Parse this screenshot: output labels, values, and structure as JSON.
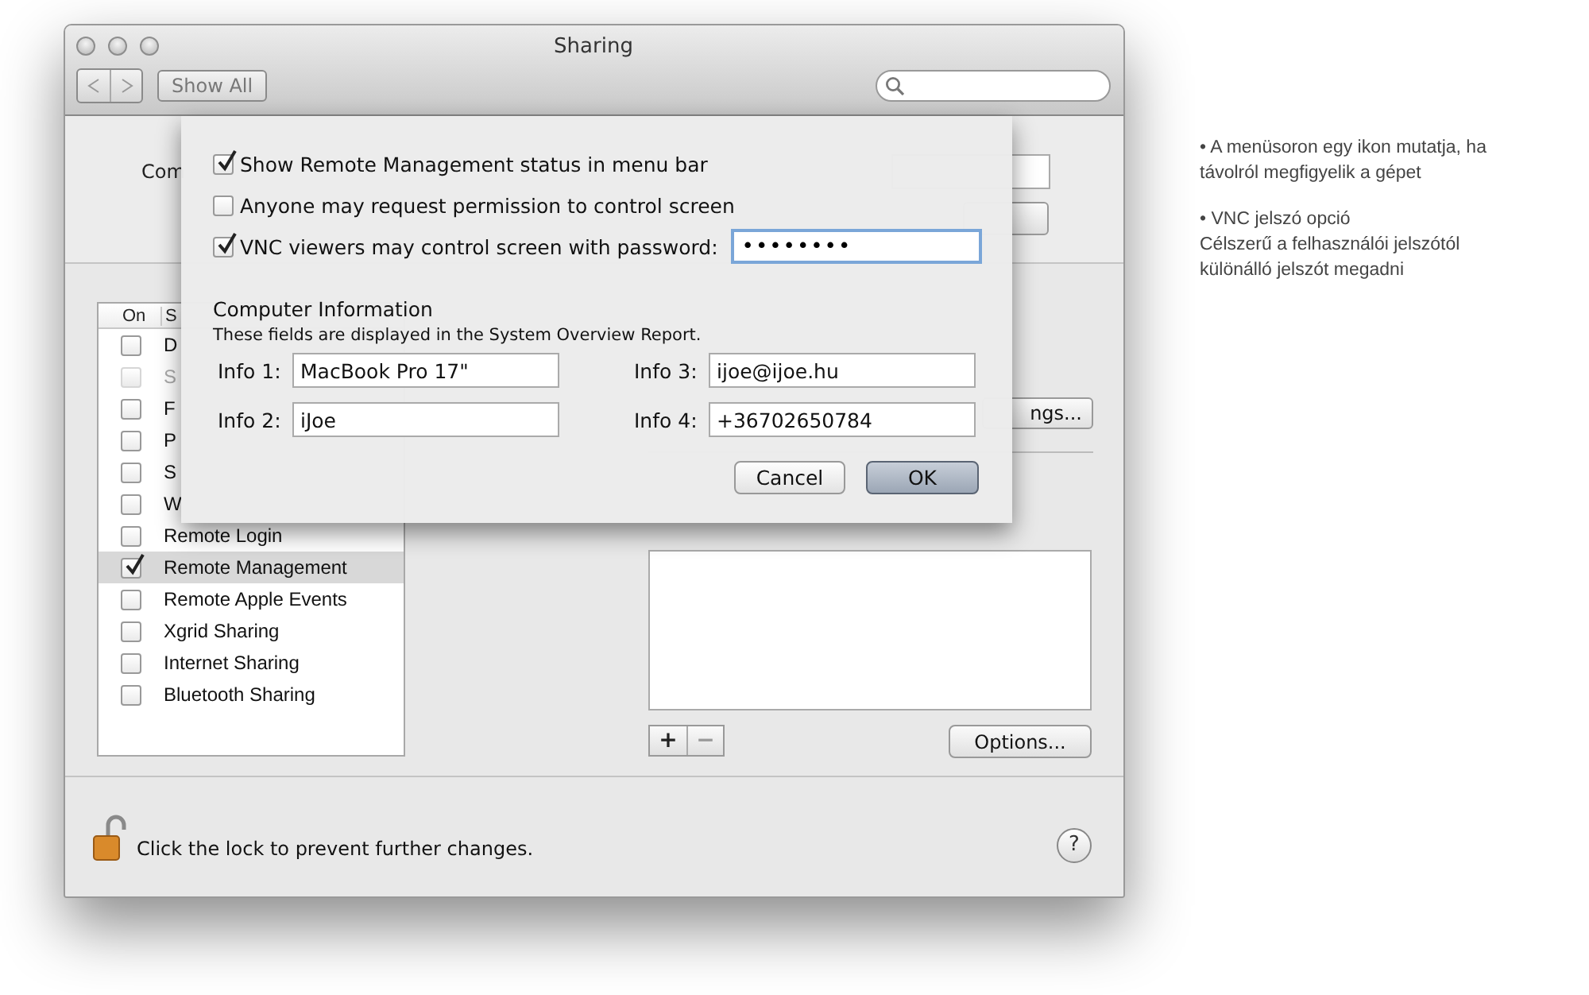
{
  "window": {
    "title": "Sharing"
  },
  "toolbar": {
    "show_all": "Show All"
  },
  "computer_name": {
    "label": "Com"
  },
  "services": {
    "columns": [
      "On",
      "S"
    ],
    "items": [
      {
        "name": "D",
        "on": false,
        "disabled": false,
        "selected": false
      },
      {
        "name": "S",
        "on": false,
        "disabled": true,
        "selected": false
      },
      {
        "name": "F",
        "on": false,
        "disabled": false,
        "selected": false
      },
      {
        "name": "P",
        "on": false,
        "disabled": false,
        "selected": false
      },
      {
        "name": "S",
        "on": false,
        "disabled": false,
        "selected": false
      },
      {
        "name": "W",
        "on": false,
        "disabled": false,
        "selected": false
      },
      {
        "name": "Remote Login",
        "on": false,
        "disabled": false,
        "selected": false
      },
      {
        "name": "Remote Management",
        "on": true,
        "disabled": false,
        "selected": true
      },
      {
        "name": "Remote Apple Events",
        "on": false,
        "disabled": false,
        "selected": false
      },
      {
        "name": "Xgrid Sharing",
        "on": false,
        "disabled": false,
        "selected": false
      },
      {
        "name": "Internet Sharing",
        "on": false,
        "disabled": false,
        "selected": false
      },
      {
        "name": "Bluetooth Sharing",
        "on": false,
        "disabled": false,
        "selected": false
      }
    ]
  },
  "service_panel": {
    "settings_button": "ngs...",
    "add": "+",
    "remove": "−",
    "options_button": "Options..."
  },
  "lock": {
    "text": "Click the lock to prevent further changes."
  },
  "help": "?",
  "sheet": {
    "options": [
      {
        "label": "Show Remote Management status in menu bar",
        "checked": true
      },
      {
        "label": "Anyone may request permission to control screen",
        "checked": false
      },
      {
        "label": "VNC viewers may control screen with password:",
        "checked": true,
        "password": "••••••••"
      }
    ],
    "section_title": "Computer Information",
    "section_note": "These fields are displayed in the System Overview Report.",
    "fields": [
      {
        "label": "Info 1:",
        "value": "MacBook Pro 17\""
      },
      {
        "label": "Info 2:",
        "value": "iJoe"
      },
      {
        "label": "Info 3:",
        "value": "ijoe@ijoe.hu"
      },
      {
        "label": "Info 4:",
        "value": "+36702650784"
      }
    ],
    "buttons": [
      {
        "label": "Cancel",
        "kind": "normal"
      },
      {
        "label": "OK",
        "kind": "default"
      }
    ]
  },
  "notes": [
    {
      "lines": [
        "• A menüsoron egy ikon mutatja, ha",
        "távolról megfigyelik a gépet"
      ]
    },
    {
      "lines": [
        "• VNC jelszó opció",
        "Célszerű a felhasználói jelszótól",
        "különálló jelszót megadni"
      ]
    }
  ]
}
